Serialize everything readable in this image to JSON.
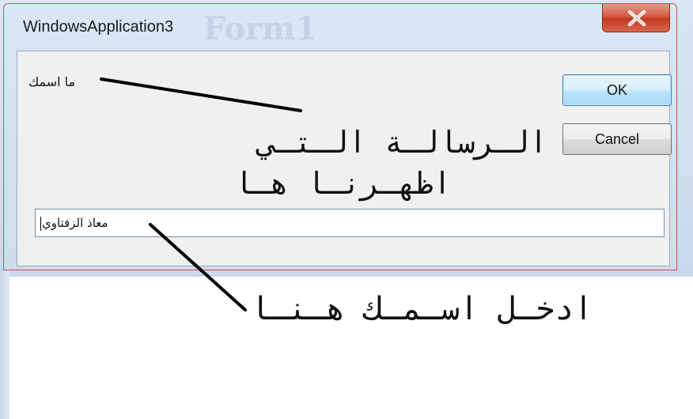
{
  "window": {
    "title": "WindowsApplication3",
    "background_title": "Form1",
    "close_symbol": "X"
  },
  "dialog": {
    "prompt": "ما اسمك",
    "ok_label": "OK",
    "cancel_label": "Cancel",
    "input_value": "معاذ الزفتاوي"
  },
  "annotations": {
    "message_line1": "الـرسالـة الـتـي",
    "message_line2": "اظهـرنـا هـا",
    "input_hint": "ادخـل اسـمـك هـنـا"
  },
  "colors": {
    "window_border": "#d44a4a",
    "close_button": "#c13b22",
    "ok_border": "#3c7fb1"
  }
}
